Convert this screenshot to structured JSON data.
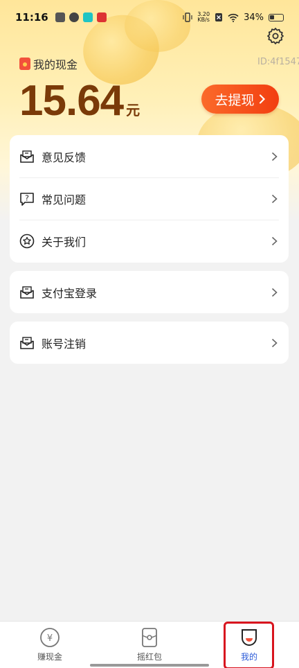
{
  "status_bar": {
    "time": "11:16",
    "speed_value": "3.20",
    "speed_unit": "KB/s",
    "battery": "34%"
  },
  "header": {
    "cash_label": "我的现金",
    "user_id": "ID:4f1547",
    "amount": "15.64",
    "amount_unit": "元",
    "withdraw_label": "去提现"
  },
  "menu_groups": [
    {
      "items": [
        {
          "label": "意见反馈",
          "icon": "mail-icon"
        },
        {
          "label": "常见问题",
          "icon": "question-bubble-icon"
        },
        {
          "label": "关于我们",
          "icon": "star-circle-icon"
        }
      ]
    },
    {
      "items": [
        {
          "label": "支付宝登录",
          "icon": "mail-icon"
        }
      ]
    },
    {
      "items": [
        {
          "label": "账号注销",
          "icon": "mail-icon"
        }
      ]
    }
  ],
  "tab_bar": {
    "tabs": [
      {
        "label": "赚现金",
        "icon": "yen-coin-icon"
      },
      {
        "label": "摇红包",
        "icon": "red-envelope-icon"
      },
      {
        "label": "我的",
        "icon": "profile-icon"
      }
    ],
    "active_tab": "我的"
  },
  "colors": {
    "accent_orange": "#f23e10",
    "amount_brown": "#7a3a08",
    "active_tab_blue": "#2b5bd8",
    "highlight_red": "#d8141e"
  }
}
